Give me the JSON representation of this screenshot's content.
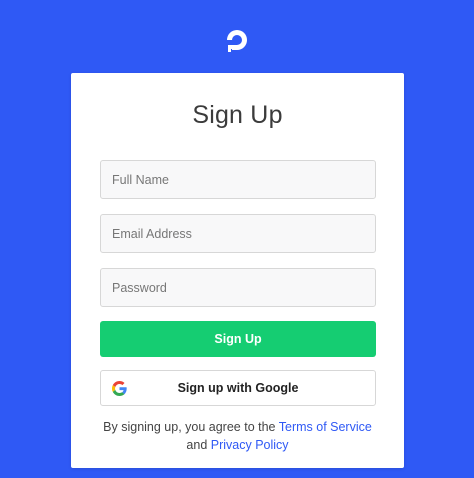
{
  "brand": {
    "logo_icon": "digitalocean-logo-icon",
    "background_color": "#2f59f5"
  },
  "signup": {
    "title": "Sign Up",
    "full_name_placeholder": "Full Name",
    "email_placeholder": "Email Address",
    "password_placeholder": "Password",
    "submit_label": "Sign Up",
    "submit_color": "#15cd72",
    "google_label": "Sign up with Google",
    "google_icon": "google-g-icon"
  },
  "legal": {
    "prefix": "By signing up, you agree to the",
    "terms_link": "Terms of Service",
    "conjunction": "and",
    "privacy_link": "Privacy Policy"
  }
}
